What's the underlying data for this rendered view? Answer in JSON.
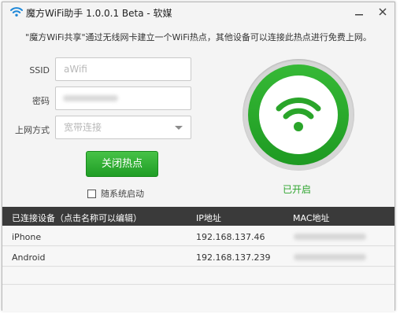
{
  "window": {
    "title": "魔方WiFi助手 1.0.0.1 Beta - 软媒",
    "minimize_glyph": "—",
    "close_glyph": "✕"
  },
  "description": "\"魔方WiFi共享\"通过无线网卡建立一个WiFi热点，其他设备可以连接此热点进行免费上网。",
  "form": {
    "ssid_label": "SSID",
    "ssid_value": "aWifi",
    "password_label": "密码",
    "mode_label": "上网方式",
    "mode_value": "宽带连接",
    "toggle_button": "关闭热点",
    "autostart_label": "随系统启动",
    "autostart_checked": false
  },
  "status": {
    "label": "已开启",
    "icon": "wifi-icon",
    "accent_color": "#2ea52e"
  },
  "table": {
    "headers": {
      "device": "已连接设备（点击名称可以编辑）",
      "ip": "IP地址",
      "mac": "MAC地址"
    },
    "rows": [
      {
        "name": "iPhone",
        "ip": "192.168.137.46"
      },
      {
        "name": "Android",
        "ip": "192.168.137.239"
      }
    ]
  }
}
